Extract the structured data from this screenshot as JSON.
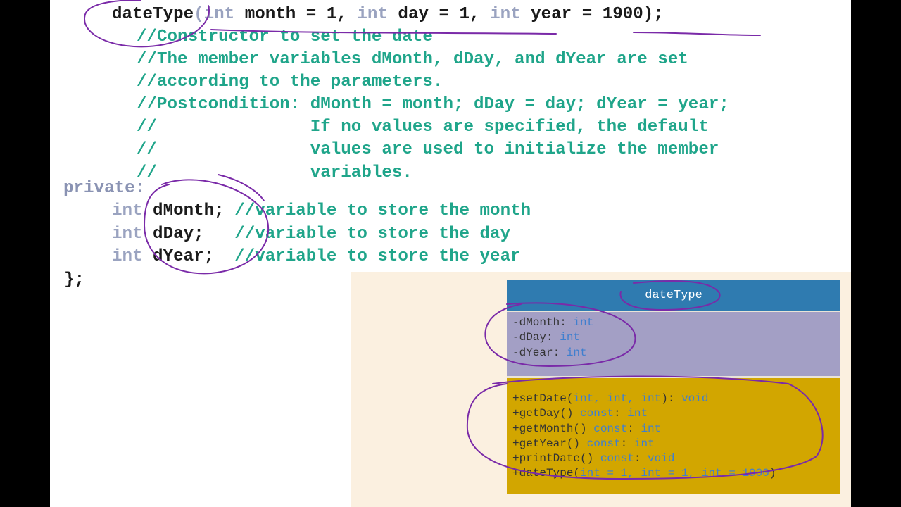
{
  "constructor": {
    "name": "dateType",
    "open": "(",
    "kw1": "int",
    "p1": " month = 1, ",
    "kw2": "int",
    "p2": " day = 1, ",
    "kw3": "int",
    "p3": " year = 1900);"
  },
  "comments": [
    "//Constructor to set the date",
    "//The member variables dMonth, dDay, and dYear are set",
    "//according to the parameters.",
    "//Postcondition: dMonth = month; dDay = day; dYear = year;",
    "//               If no values are specified, the default",
    "//               values are used to initialize the member",
    "//               variables."
  ],
  "private_label": "private:",
  "members": [
    {
      "type": "int",
      "decl": " dMonth; ",
      "comment": "//variable to store the month"
    },
    {
      "type": "int",
      "decl": " dDay;   ",
      "comment": "//variable to store the day"
    },
    {
      "type": "int",
      "decl": " dYear;  ",
      "comment": "//variable to store the year"
    }
  ],
  "closing": "};",
  "uml": {
    "title": "dateType",
    "attributes": [
      {
        "name": "-dMonth: ",
        "type": "int"
      },
      {
        "name": "-dDay: ",
        "type": "int"
      },
      {
        "name": "-dYear: ",
        "type": "int"
      }
    ],
    "methods": [
      {
        "pre": "+setDate(",
        "args": "int, int, int",
        "mid": "): ",
        "ret": "void"
      },
      {
        "pre": "+getDay() ",
        "args": "const",
        "mid": ": ",
        "ret": "int"
      },
      {
        "pre": "+getMonth() ",
        "args": "const",
        "mid": ": ",
        "ret": "int"
      },
      {
        "pre": "+getYear() ",
        "args": "const",
        "mid": ": ",
        "ret": "int"
      },
      {
        "pre": "+printDate() ",
        "args": "const",
        "mid": ": ",
        "ret": "void"
      },
      {
        "pre": "+dateType(",
        "args": "int = 1, int = 1, int = 1900",
        "mid": ")",
        "ret": ""
      }
    ]
  },
  "colors": {
    "keyword": "#9aa3c0",
    "comment": "#1fa58a",
    "ink": "#7a2aa8",
    "uml_title_bg": "#2f7bb0",
    "uml_attr_bg": "#a39fc5",
    "uml_method_bg": "#d2a600",
    "panel_bg": "#fbf0e0"
  }
}
